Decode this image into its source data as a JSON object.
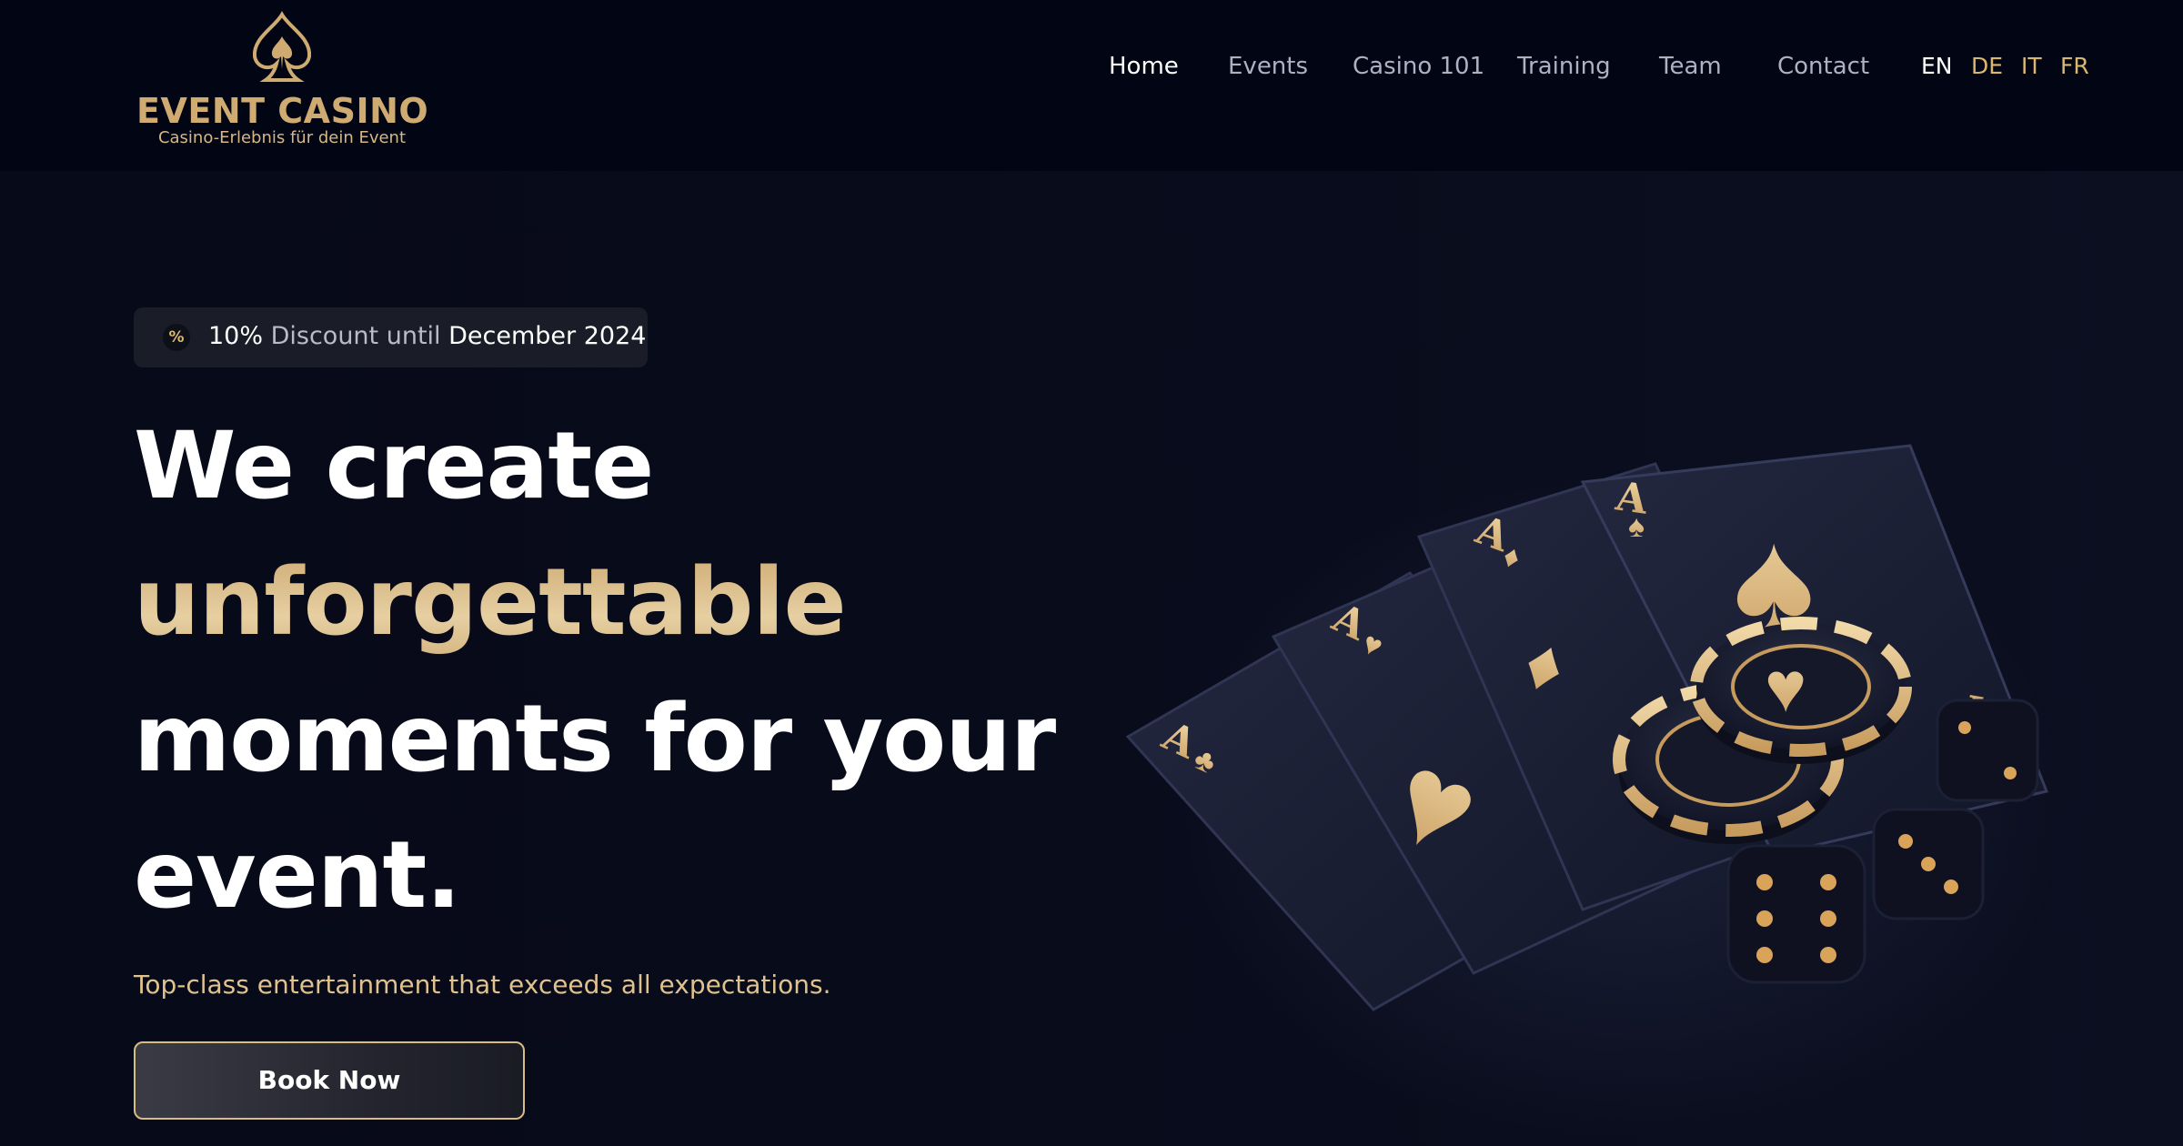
{
  "header": {
    "logo": {
      "name": "EVENT CASINO",
      "tagline": "Casino-Erlebnis für dein Event"
    },
    "nav": [
      {
        "label": "Home",
        "active": true
      },
      {
        "label": "Events",
        "active": false
      },
      {
        "label": "Casino 101",
        "active": false
      },
      {
        "label": "Training",
        "active": false
      },
      {
        "label": "Team",
        "active": false
      },
      {
        "label": "Contact",
        "active": false
      }
    ],
    "languages": [
      {
        "label": "EN",
        "active": true
      },
      {
        "label": "DE",
        "active": false
      },
      {
        "label": "IT",
        "active": false
      },
      {
        "label": "FR",
        "active": false
      }
    ]
  },
  "hero": {
    "badge": {
      "icon": "percent-icon",
      "strong_1": "10%",
      "text": " Discount until ",
      "strong_2": "December 2024"
    },
    "headline": {
      "line1": "We create",
      "line2": "unforgettable",
      "line3": "moments for your",
      "line4": "event."
    },
    "subline": "Top-class entertainment that exceeds all expectations.",
    "cta_label": "Book Now",
    "image": "playing-cards-chips-dice-illustration"
  },
  "colors": {
    "background": "#070a18",
    "header": "#020514",
    "gold": "#cfab72",
    "white": "#ffffff",
    "muted": "#aeb1c2"
  }
}
